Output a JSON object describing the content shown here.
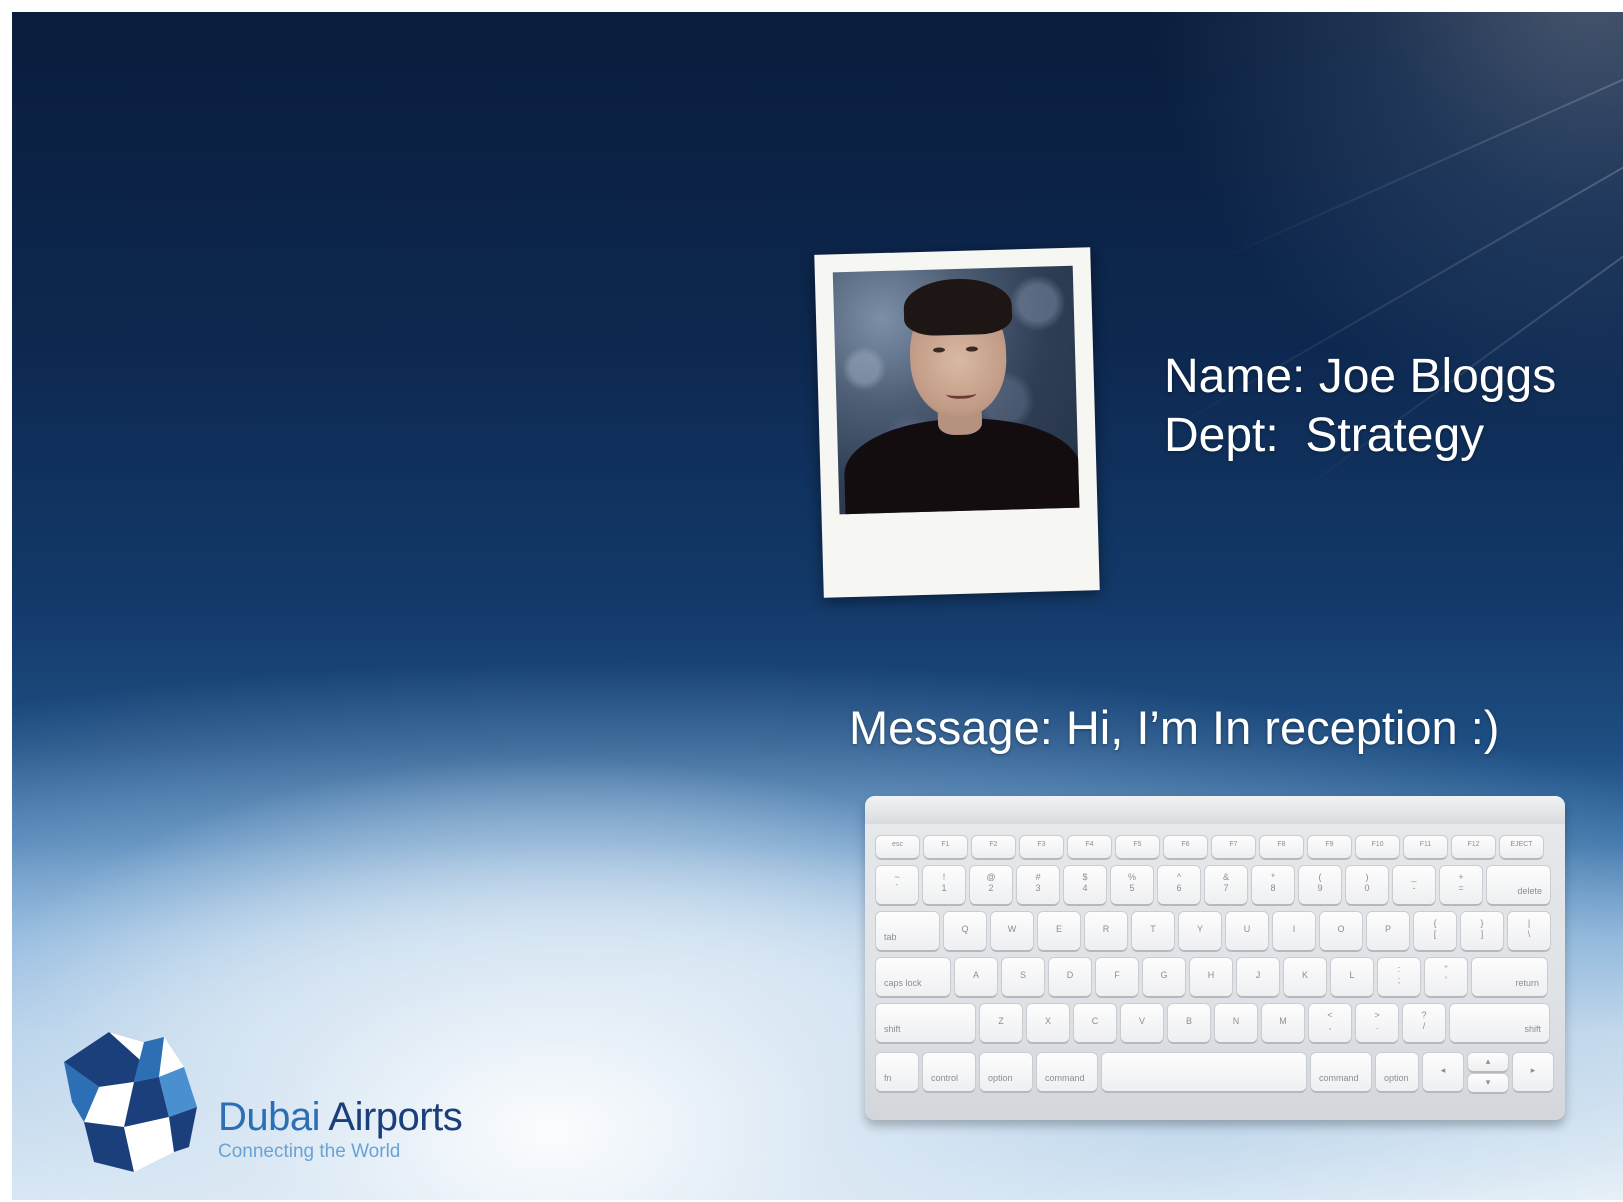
{
  "profile": {
    "name_line": "Name: Joe Bloggs",
    "dept_line": "Dept:  Strategy"
  },
  "message": {
    "text": "Message: Hi, I’m In reception :)"
  },
  "keyboard": {
    "function_row": [
      "esc",
      "F1",
      "F2",
      "F3",
      "F4",
      "F5",
      "F6",
      "F7",
      "F8",
      "F9",
      "F10",
      "F11",
      "F12",
      "EJECT"
    ],
    "number_row": [
      [
        "~",
        "`"
      ],
      [
        "!",
        "1"
      ],
      [
        "@",
        "2"
      ],
      [
        "#",
        "3"
      ],
      [
        "$",
        "4"
      ],
      [
        "%",
        "5"
      ],
      [
        "^",
        "6"
      ],
      [
        "&",
        "7"
      ],
      [
        "*",
        "8"
      ],
      [
        "(",
        "9"
      ],
      [
        ")",
        "0"
      ],
      [
        "_",
        "-"
      ],
      [
        "+",
        "="
      ]
    ],
    "delete": "delete",
    "tab": "tab",
    "qwerty_row": [
      "Q",
      "W",
      "E",
      "R",
      "T",
      "Y",
      "U",
      "I",
      "O",
      "P",
      [
        "{",
        "["
      ],
      [
        "}",
        "]"
      ],
      [
        "|",
        "\\"
      ]
    ],
    "caps_lock": "caps lock",
    "home_row": [
      "A",
      "S",
      "D",
      "F",
      "G",
      "H",
      "J",
      "K",
      "L",
      [
        ":",
        ";"
      ],
      [
        "\"",
        "'"
      ]
    ],
    "return": "return",
    "shift_left": "shift",
    "bottom_row": [
      "Z",
      "X",
      "C",
      "V",
      "B",
      "N",
      "M",
      [
        "<",
        ","
      ],
      [
        ">",
        "."
      ],
      [
        "?",
        "/"
      ]
    ],
    "shift_right": "shift",
    "modifiers_left": [
      "fn",
      "control",
      "option",
      "command"
    ],
    "modifiers_right": [
      "command",
      "option"
    ],
    "arrows": {
      "left": "◂",
      "up": "▴",
      "down": "▾",
      "right": "▸"
    }
  },
  "branding": {
    "name_part1": "Dubai",
    "name_part2": " Airports",
    "tagline": "Connecting the World",
    "colors": {
      "primary": "#1b3f7a",
      "accent": "#2d6fb5",
      "light": "#6aa2d4"
    }
  }
}
